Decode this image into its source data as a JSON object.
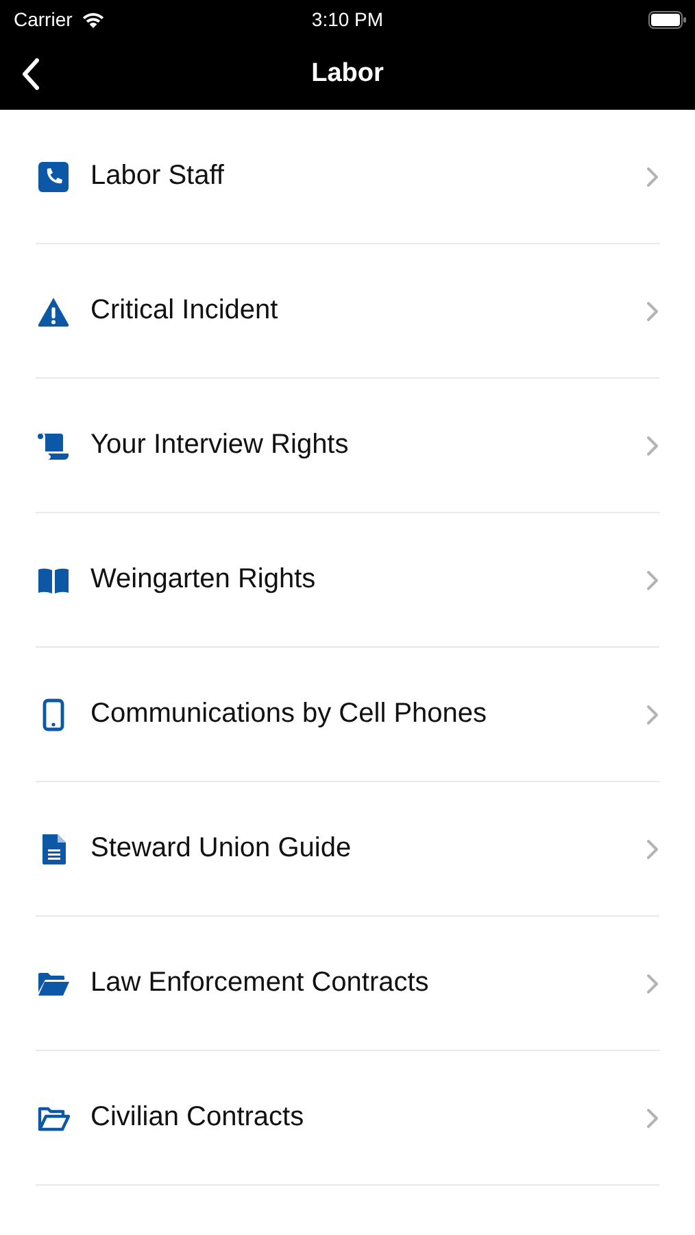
{
  "status_bar": {
    "carrier": "Carrier",
    "time": "3:10 PM"
  },
  "nav": {
    "title": "Labor"
  },
  "items": [
    {
      "label": "Labor Staff"
    },
    {
      "label": "Critical Incident"
    },
    {
      "label": "Your Interview Rights"
    },
    {
      "label": "Weingarten Rights"
    },
    {
      "label": "Communications by Cell Phones"
    },
    {
      "label": "Steward Union Guide"
    },
    {
      "label": "Law Enforcement Contracts"
    },
    {
      "label": "Civilian Contracts"
    }
  ]
}
